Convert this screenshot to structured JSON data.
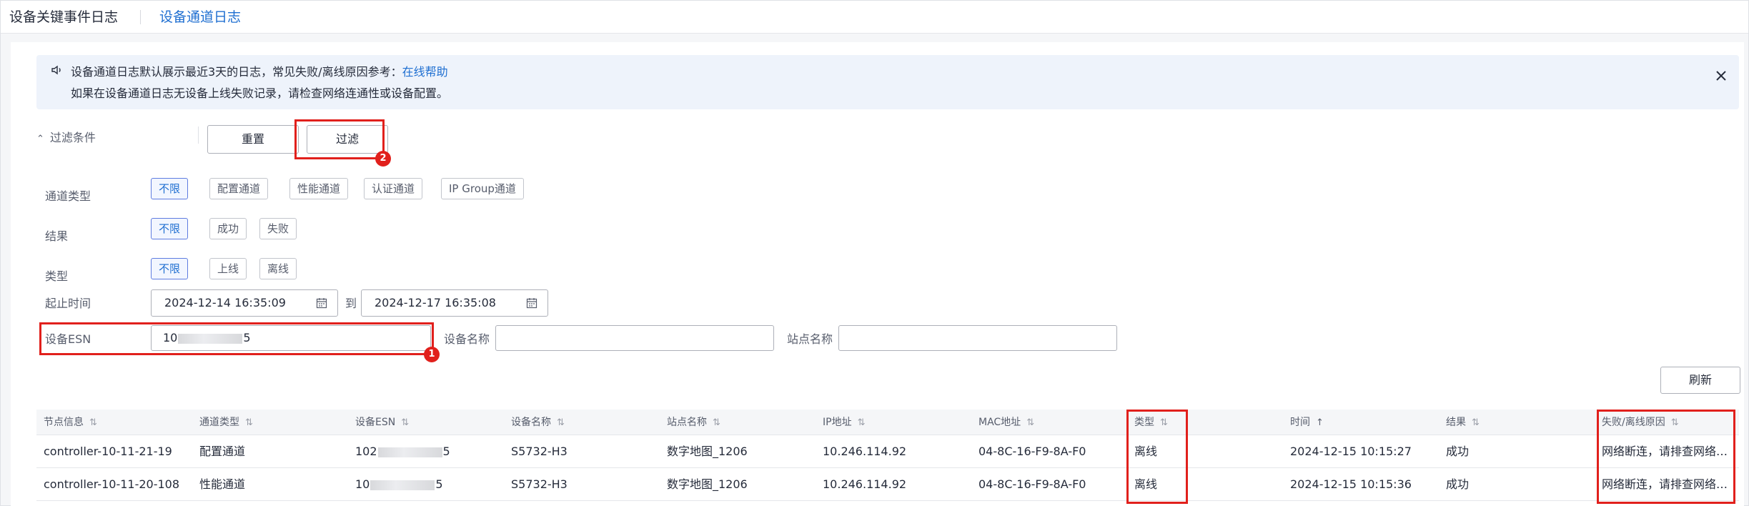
{
  "tabs": {
    "key_events": "设备关键事件日志",
    "channel_log": "设备通道日志"
  },
  "notice": {
    "line1_text": "设备通道日志默认展示最近3天的日志，常见失败/离线原因参考：",
    "line1_link": "在线帮助",
    "line2_text": "如果在设备通道日志无设备上线失败记录，请检查网络连通性或设备配置。"
  },
  "filter": {
    "toggle_label": "过滤条件",
    "reset_label": "重置",
    "filter_label": "过滤",
    "channel_type": {
      "label": "通道类型",
      "options": [
        "不限",
        "配置通道",
        "性能通道",
        "认证通道",
        "IP Group通道"
      ],
      "selected": 0
    },
    "result": {
      "label": "结果",
      "options": [
        "不限",
        "成功",
        "失败"
      ],
      "selected": 0
    },
    "type": {
      "label": "类型",
      "options": [
        "不限",
        "上线",
        "离线"
      ],
      "selected": 0
    },
    "time_range": {
      "label": "起止时间",
      "start": "2024-12-14 16:35:09",
      "separator": "到",
      "end": "2024-12-17 16:35:08"
    },
    "esn": {
      "label": "设备ESN",
      "value_prefix": "10",
      "value_suffix": "5"
    },
    "device_name": {
      "label": "设备名称",
      "value": ""
    },
    "site_name": {
      "label": "站点名称",
      "value": ""
    }
  },
  "refresh_label": "刷新",
  "table": {
    "columns": [
      {
        "label": "节点信息",
        "sort": "⇅"
      },
      {
        "label": "通道类型",
        "sort": "⇅"
      },
      {
        "label": "设备ESN",
        "sort": "⇅"
      },
      {
        "label": "设备名称",
        "sort": "⇅"
      },
      {
        "label": "站点名称",
        "sort": "⇅"
      },
      {
        "label": "IP地址",
        "sort": "⇅"
      },
      {
        "label": "MAC地址",
        "sort": "⇅"
      },
      {
        "label": "类型",
        "sort": "⇅"
      },
      {
        "label": "时间",
        "sort": "↑"
      },
      {
        "label": "结果",
        "sort": "⇅"
      },
      {
        "label": "失败/离线原因",
        "sort": "⇅"
      }
    ],
    "rows": [
      {
        "node": "controller-10-11-21-19",
        "channel_type": "配置通道",
        "esn_prefix": "102",
        "esn_suffix": "5",
        "device_name": "S5732-H3",
        "site_name": "数字地图_1206",
        "ip": "10.246.114.92",
        "mac": "04-8C-16-F9-8A-F0",
        "type": "离线",
        "time": "2024-12-15 10:15:27",
        "result": "成功",
        "reason": "网络断连，请排查网络…"
      },
      {
        "node": "controller-10-11-20-108",
        "channel_type": "性能通道",
        "esn_prefix": "10",
        "esn_suffix": "5",
        "device_name": "S5732-H3",
        "site_name": "数字地图_1206",
        "ip": "10.246.114.92",
        "mac": "04-8C-16-F9-8A-F0",
        "type": "离线",
        "time": "2024-12-15 10:15:36",
        "result": "成功",
        "reason": "网络断连，请排查网络…"
      }
    ]
  },
  "annotations": {
    "badge_1": "1",
    "badge_2": "2"
  },
  "colors": {
    "accent": "#1f6fd1",
    "highlight": "#e1201c",
    "notice_bg": "#eef3fb"
  }
}
